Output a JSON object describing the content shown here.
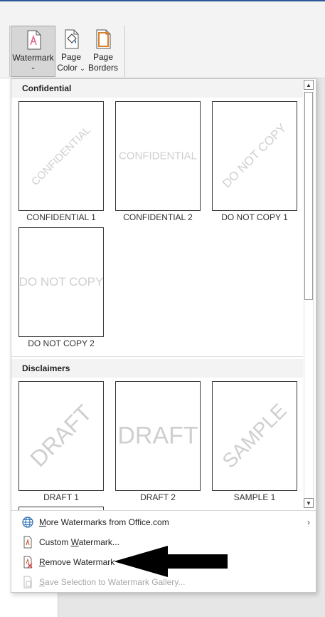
{
  "ribbon": {
    "watermark_label": "Watermark",
    "page_color_line1": "Page",
    "page_color_line2": "Color",
    "page_borders_line1": "Page",
    "page_borders_line2": "Borders",
    "caret": "⌄"
  },
  "gallery": {
    "sections": [
      {
        "title": "Confidential",
        "items": [
          {
            "caption": "CONFIDENTIAL 1",
            "watermark_text": "CONFIDENTIAL",
            "diagonal": true
          },
          {
            "caption": "CONFIDENTIAL 2",
            "watermark_text": "CONFIDENTIAL",
            "diagonal": false
          },
          {
            "caption": "DO NOT COPY 1",
            "watermark_text": "DO NOT COPY",
            "diagonal": true
          },
          {
            "caption": "DO NOT COPY 2",
            "watermark_text": "DO NOT COPY",
            "diagonal": false
          }
        ]
      },
      {
        "title": "Disclaimers",
        "items": [
          {
            "caption": "DRAFT 1",
            "watermark_text": "DRAFT",
            "diagonal": true
          },
          {
            "caption": "DRAFT 2",
            "watermark_text": "DRAFT",
            "diagonal": false
          },
          {
            "caption": "SAMPLE 1",
            "watermark_text": "SAMPLE",
            "diagonal": true
          }
        ]
      }
    ]
  },
  "menu": {
    "more_watermarks": {
      "key": "M",
      "rest": "ore Watermarks from Office.com"
    },
    "custom_watermark": {
      "pre": "Custom ",
      "key": "W",
      "rest": "atermark..."
    },
    "remove_watermark": {
      "key": "R",
      "rest": "emove Watermark"
    },
    "save_selection": {
      "key": "S",
      "rest": "ave Selection to Watermark Gallery..."
    }
  },
  "colors": {
    "accent": "#2b579a",
    "watermark_gray": "#cfcfcf",
    "icon_orange": "#c9572c",
    "disabled_text": "#a6a6a6"
  },
  "icons": {
    "watermark": "watermark-icon",
    "page_color": "page-color-icon",
    "page_borders": "page-borders-icon",
    "globe": "globe-icon",
    "custom": "custom-watermark-icon",
    "remove": "remove-watermark-icon",
    "save": "save-selection-icon"
  }
}
